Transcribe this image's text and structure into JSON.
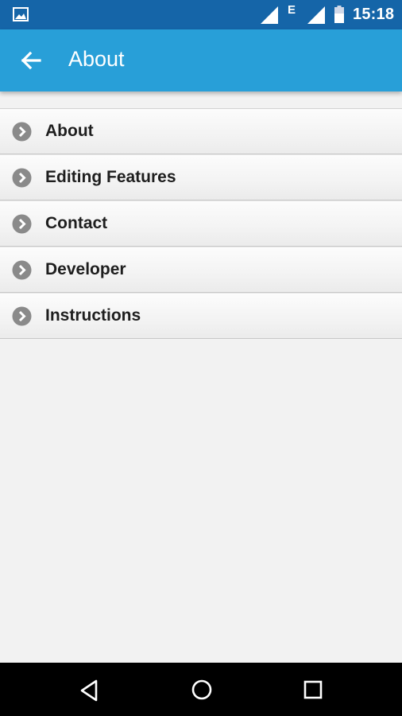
{
  "status_bar": {
    "network_type": "E",
    "time": "15:18"
  },
  "app_bar": {
    "title": "About"
  },
  "menu": {
    "items": [
      {
        "label": "About"
      },
      {
        "label": "Editing Features"
      },
      {
        "label": "Contact"
      },
      {
        "label": "Developer"
      },
      {
        "label": "Instructions"
      }
    ]
  },
  "icons": {
    "status": [
      "gallery-icon",
      "signal-icon",
      "signal-icon",
      "battery-icon"
    ],
    "app_bar": "arrow-back-icon",
    "list_item": "chevron-right-circle-icon",
    "nav": [
      "triangle-back-icon",
      "circle-home-icon",
      "square-recents-icon"
    ]
  },
  "colors": {
    "status_bar": "#1565a8",
    "app_bar": "#289fd8",
    "background": "#f2f2f2",
    "chevron": "#8a8a8a",
    "nav_bar": "#000000"
  }
}
